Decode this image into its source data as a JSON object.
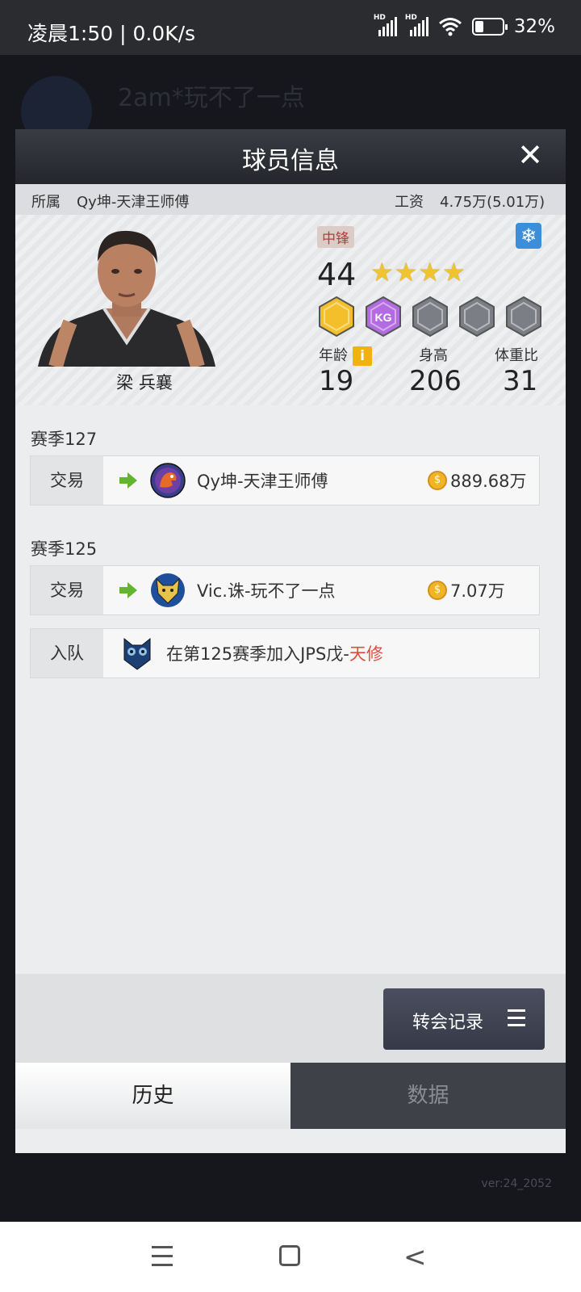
{
  "status_bar": {
    "time": "凌晨1:50 | 0.0K/s",
    "battery_percent": "32%",
    "battery_level": 0.32,
    "hd_label": "HD"
  },
  "background": {
    "team_title": "2am*玩不了一点",
    "version": "ver:24_2052"
  },
  "modal": {
    "title": "球员信息",
    "close_icon": "close-icon",
    "affiliation_label": "所属",
    "affiliation_value": "Qy坤-天津王师傅",
    "salary_label": "工资",
    "salary_value": "4.75万(5.01万)"
  },
  "player": {
    "name": "梁 兵襄",
    "position": "中锋",
    "rating": "44",
    "star_count": 4,
    "stars": [
      "★",
      "★",
      "★",
      "★"
    ],
    "badges": [
      {
        "name": "gold-player-badge",
        "label": "",
        "color": "#f3bf2a"
      },
      {
        "name": "kg-badge",
        "label": "KG",
        "color": "#b26be0"
      },
      {
        "name": "locked-badge-1",
        "label": "",
        "color": "#7b7e84"
      },
      {
        "name": "locked-badge-2",
        "label": "",
        "color": "#7b7e84"
      },
      {
        "name": "locked-badge-3",
        "label": "",
        "color": "#7b7e84"
      }
    ],
    "age_label": "年龄",
    "age_value": "19",
    "height_label": "身高",
    "height_value": "206",
    "weight_label": "体重比",
    "weight_value": "31",
    "info_icon_text": "i",
    "snow_icon": "❄"
  },
  "history": [
    {
      "season": "赛季127",
      "records": [
        {
          "type": "交易",
          "team": "Qy坤-天津王师傅",
          "amount": "889.68万",
          "logo": "dino-logo"
        }
      ]
    },
    {
      "season": "赛季125",
      "records": [
        {
          "type": "交易",
          "team": "Vic.诛-玩不了一点",
          "amount": "7.07万",
          "logo": "wolf-logo"
        },
        {
          "type": "入队",
          "text_prefix": "在第125赛季加入JPS戊-",
          "text_highlight": "天修",
          "logo": "owl-logo"
        }
      ]
    }
  ],
  "transfer_button": "转会记录",
  "tabs": {
    "history": "历史",
    "data": "数据"
  },
  "colors": {
    "accent_red": "#e24b3c",
    "coin_gold": "#f0b429",
    "arrow_green": "#62b52f"
  }
}
